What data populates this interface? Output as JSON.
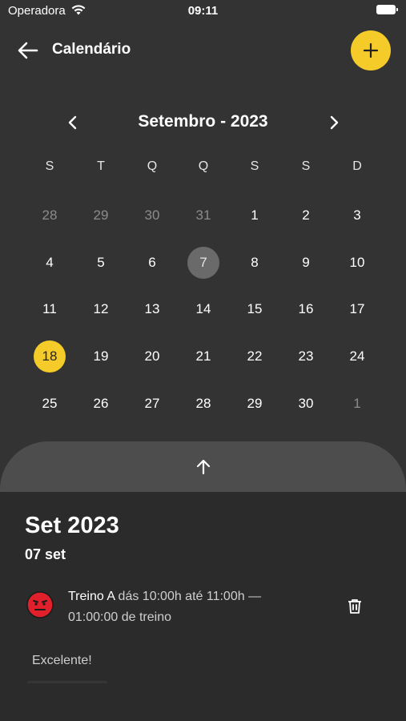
{
  "status_bar": {
    "carrier": "Operadora",
    "time": "09:11"
  },
  "header": {
    "title": "Calendário"
  },
  "calendar": {
    "month_label": "Setembro - 2023",
    "weekdays": [
      "S",
      "T",
      "Q",
      "Q",
      "S",
      "S",
      "D"
    ],
    "weeks": [
      [
        "28",
        "29",
        "30",
        "31",
        "1",
        "2",
        "3"
      ],
      [
        "4",
        "5",
        "6",
        "7",
        "8",
        "9",
        "10"
      ],
      [
        "11",
        "12",
        "13",
        "14",
        "15",
        "16",
        "17"
      ],
      [
        "18",
        "19",
        "20",
        "21",
        "22",
        "23",
        "24"
      ],
      [
        "25",
        "26",
        "27",
        "28",
        "29",
        "30",
        "1"
      ]
    ],
    "selected_day": "7",
    "today": "18"
  },
  "panel": {
    "title": "Set 2023",
    "date": "07 set",
    "entry": {
      "name": "Treino A",
      "detail": " dás 10:00h até 11:00h — 01:00:00 de treino"
    },
    "note": "Excelente!"
  },
  "colors": {
    "accent": "#f5cb2a",
    "background": "#333333",
    "panel": "#2b2b2b",
    "mood_face": "#e0202a"
  }
}
